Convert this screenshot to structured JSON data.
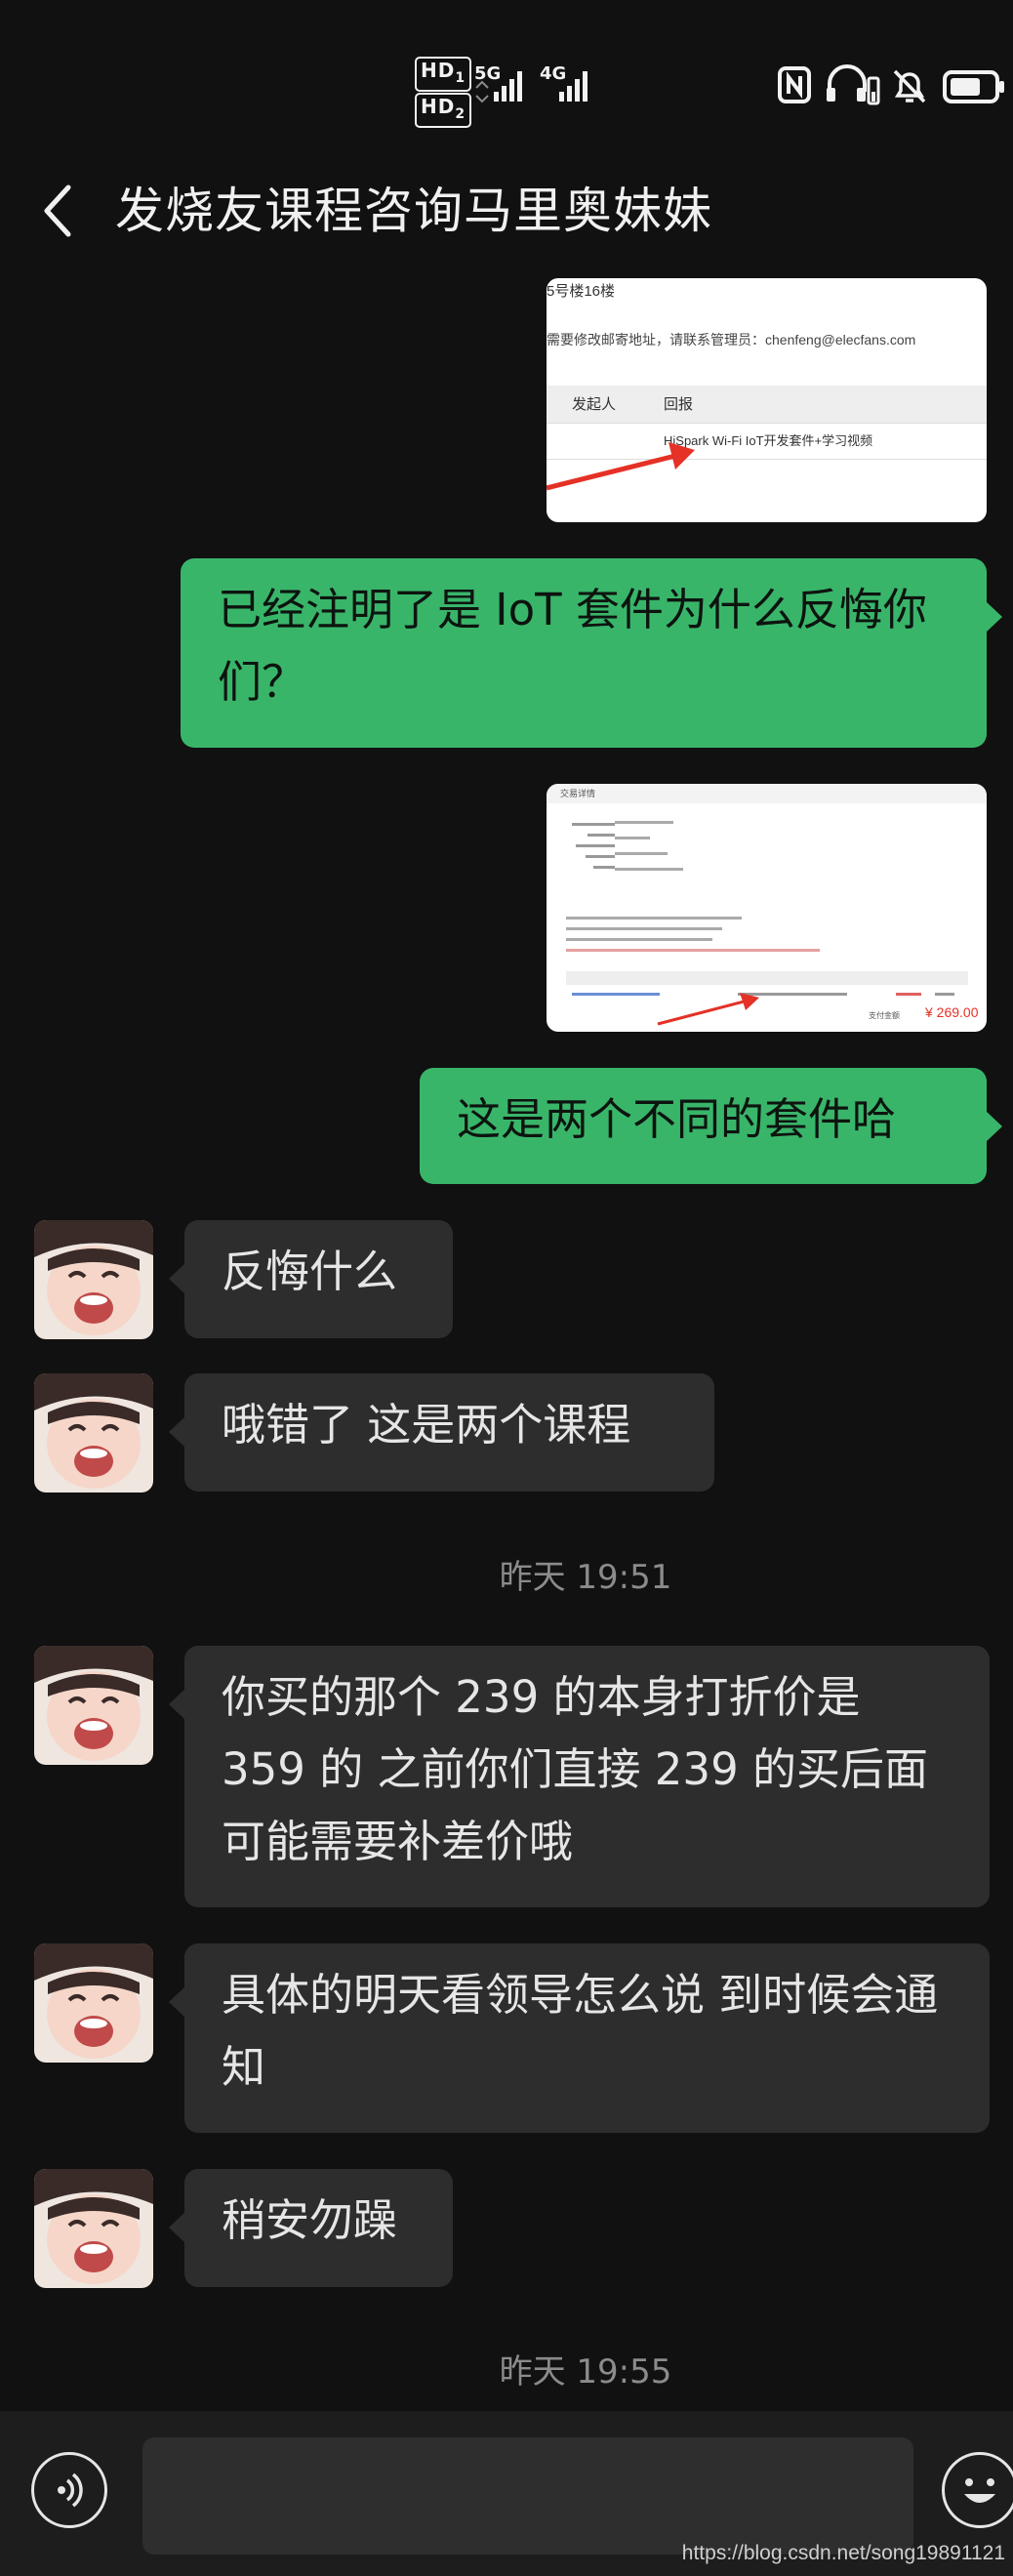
{
  "status_bar": {
    "hd1": "HD",
    "hd1_sub": "1",
    "hd2": "HD",
    "hd2_sub": "2",
    "net1": "5G",
    "net2": "4G",
    "icons": [
      "nfc-icon",
      "headset-icon",
      "mute-icon",
      "battery-icon"
    ]
  },
  "header": {
    "title": "发烧友课程咨询马里奥妹妹",
    "back_icon": "chevron-left-icon"
  },
  "screenshot1": {
    "line_top": "5号楼16楼",
    "line_notice": "需要修改邮寄地址，请联系管理员：chenfeng@elecfans.com",
    "col_sender": "发起人",
    "col_return": "回报",
    "return_item": "HiSpark Wi-Fi IoT开发套件+学习视频"
  },
  "screenshot2": {
    "heading": "交易详情",
    "price": "¥ 269.00",
    "price_label": "支付金额"
  },
  "messages": {
    "m1": "已经注明了是 IoT 套件为什么反悔你们？",
    "m2": "这是两个不同的套件哈",
    "m3": "反悔什么",
    "m4": "哦错了 这是两个课程",
    "t1": "昨天 19:51",
    "m5": "你买的那个 239 的本身打折价是 359 的 之前你们直接 239 的买后面可能需要补差价哦",
    "m6": "具体的明天看领导怎么说 到时候会通知",
    "m7": "稍安勿躁",
    "t2": "昨天 19:55"
  },
  "watermark": "https://blog.csdn.net/song19891121",
  "colors": {
    "background": "#111111",
    "sent_bubble": "#39b56a",
    "received_bubble": "#2d2d2d",
    "timestamp": "#8b8b8b"
  }
}
